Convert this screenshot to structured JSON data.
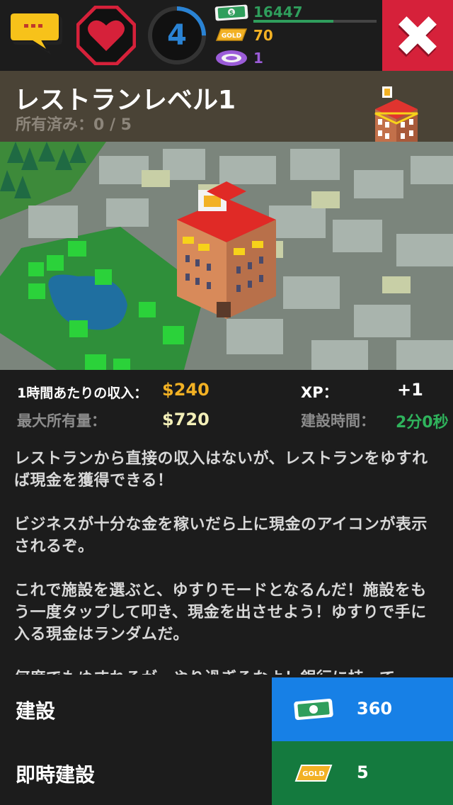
{
  "hud": {
    "level": "4",
    "level_progress": 0.25,
    "cash": "16447",
    "cash_progress": 0.65,
    "gold": "70",
    "chips": "1",
    "gold_icon_text": "GOLD",
    "cash_icon_text": "$"
  },
  "building": {
    "title": "レストランレベル1",
    "owned": "所有済み：0 / 5"
  },
  "stats": {
    "income_label": "1時間あたりの収入：",
    "income_value": "$240",
    "xp_label": "XP：",
    "xp_value": "+1",
    "max_label": "最大所有量：",
    "max_value": "$720",
    "time_label": "建設時間：",
    "time_value": "2分0秒"
  },
  "description": {
    "p1": "レストランから直接の収入はないが、レストランをゆすれば現金を獲得できる！",
    "p2": "ビジネスが十分な金を稼いだら上に現金のアイコンが表示されるぞ。",
    "p3": "これで施設を選ぶと、ゆすりモードとなるんだ！施設をもう一度タップして叩き、現金を出させよう！ゆすりで手に入る現金はランダムだ。",
    "p4": "何度でもゆすれるが、やり過ぎるなよ！銀行に持って"
  },
  "actions": {
    "build_label": "建設",
    "build_price": "360",
    "instant_label": "即時建設",
    "instant_price": "5"
  },
  "colors": {
    "close": "#d6213a",
    "cash_button": "#1780e6",
    "gold_button": "#147a3e",
    "income": "#f2b124",
    "time": "#2fb35c"
  },
  "icons": [
    "chat-icon",
    "heart-icon",
    "level-ring-icon",
    "cash-icon",
    "gold-icon",
    "chip-icon",
    "close-icon"
  ]
}
